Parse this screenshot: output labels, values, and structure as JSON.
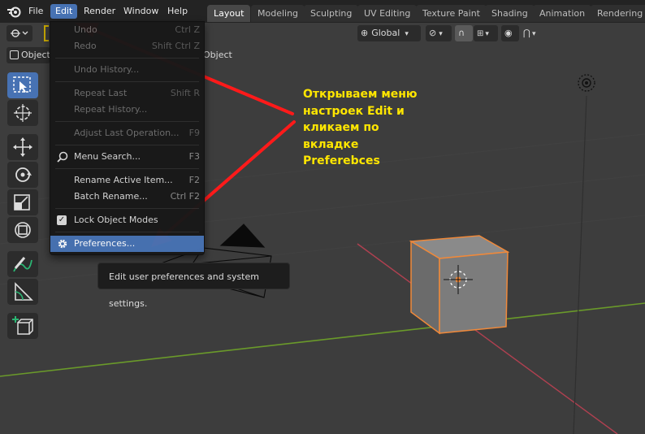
{
  "menubar": {
    "items": [
      "File",
      "Edit",
      "Render",
      "Window",
      "Help"
    ]
  },
  "workspaces": [
    "Layout",
    "Modeling",
    "Sculpting",
    "UV Editing",
    "Texture Paint",
    "Shading",
    "Animation",
    "Rendering"
  ],
  "header": {
    "mode_label": "Object",
    "object_menu_label": "Object",
    "transform_orientation": "Global"
  },
  "edit_menu": {
    "items": [
      {
        "label": "Undo",
        "shortcut": "Ctrl Z",
        "disabled": true
      },
      {
        "label": "Redo",
        "shortcut": "Shift Ctrl Z",
        "disabled": true
      },
      {
        "label": "Undo History...",
        "shortcut": "",
        "disabled": true
      },
      {
        "label": "Repeat Last",
        "shortcut": "Shift R",
        "disabled": true
      },
      {
        "label": "Repeat History...",
        "shortcut": "",
        "disabled": true
      },
      {
        "label": "Adjust Last Operation...",
        "shortcut": "F9",
        "disabled": true
      },
      {
        "label": "Menu Search...",
        "shortcut": "F3",
        "disabled": false
      },
      {
        "label": "Rename Active Item...",
        "shortcut": "F2",
        "disabled": false
      },
      {
        "label": "Batch Rename...",
        "shortcut": "Ctrl F2",
        "disabled": false
      },
      {
        "label": "Lock Object Modes",
        "shortcut": "",
        "disabled": false,
        "checked": true
      },
      {
        "label": "Preferences...",
        "shortcut": "",
        "disabled": false,
        "highlighted": true
      }
    ]
  },
  "tooltip": "Edit user preferences and system settings.",
  "annotation": {
    "lines": [
      "Открываем меню",
      "настроек Edit и",
      "кликаем по",
      "вкладке",
      "Preferebces"
    ],
    "color": "#ffe600"
  },
  "colors": {
    "accent": "#4772b3",
    "arrow": "#ff1a1a",
    "selection_outline": "#f0893a",
    "x_axis": "#b04050",
    "y_axis": "#6a9a2a"
  }
}
